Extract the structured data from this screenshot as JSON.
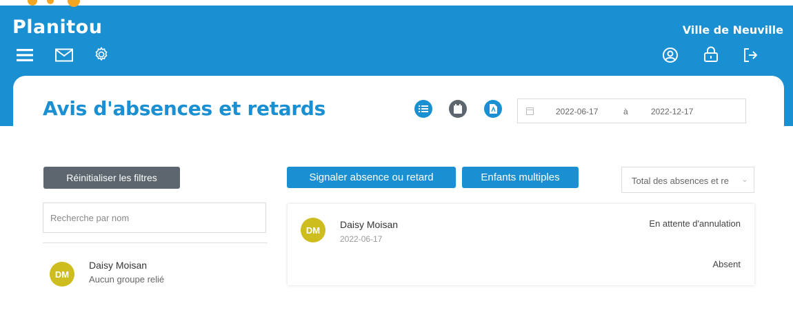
{
  "app": {
    "brand": "Planitou",
    "organization": "Ville de Neuville"
  },
  "colors": {
    "primary": "#1a8fd2",
    "secondary_button": "#5d666e",
    "avatar": "#cdbd1e",
    "logo_accent": "#f4a623"
  },
  "header": {
    "left_icons": [
      "menu-icon",
      "mail-icon",
      "gear-icon"
    ],
    "right_icons": [
      "user-icon",
      "lock-icon",
      "logout-icon"
    ]
  },
  "page": {
    "title": "Avis d'absences et retards",
    "view_icons": [
      "list-icon",
      "calendar-icon",
      "pdf-icon"
    ]
  },
  "date_range": {
    "from": "2022-06-17",
    "separator": "à",
    "to": "2022-12-17"
  },
  "filters": {
    "reset_label": "Réinitialiser les filtres",
    "search_placeholder": "Recherche par nom"
  },
  "actions": {
    "report_label": "Signaler absence ou retard",
    "multiple_label": "Enfants multiples",
    "select_value": "Total des absences et re"
  },
  "children": [
    {
      "initials": "DM",
      "name": "Daisy Moisan",
      "group": "Aucun groupe relié"
    }
  ],
  "entries": [
    {
      "initials": "DM",
      "name": "Daisy Moisan",
      "date": "2022-06-17",
      "status": "En attente d'annulation",
      "type": "Absent"
    }
  ]
}
